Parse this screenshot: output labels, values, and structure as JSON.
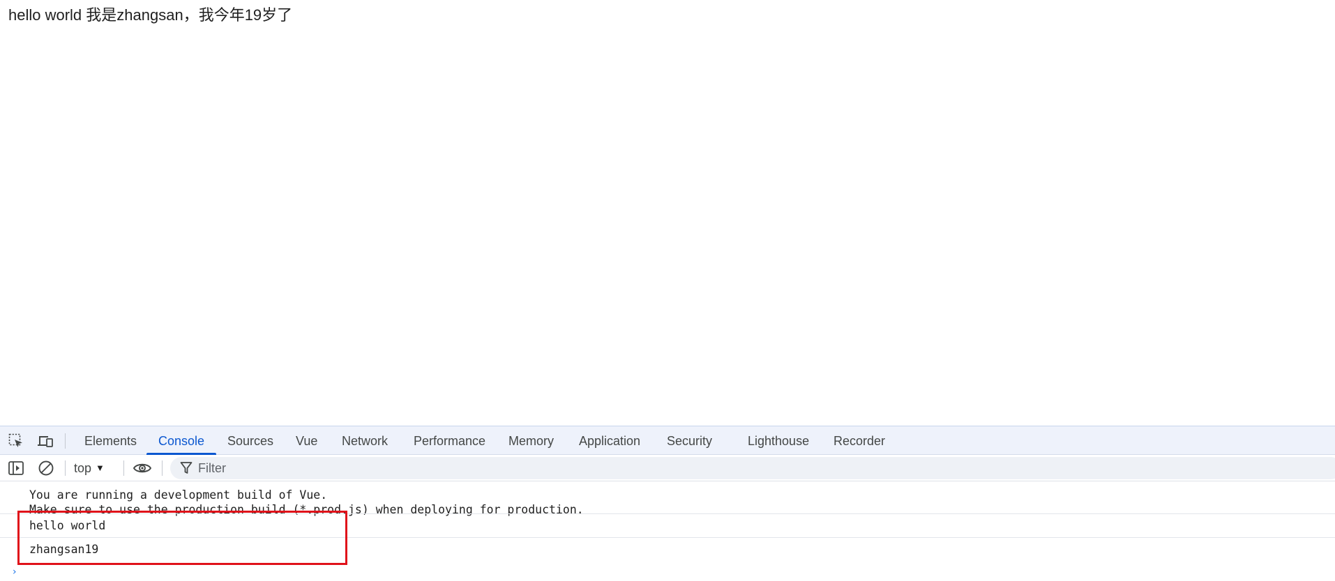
{
  "page": {
    "content_text": "hello world 我是zhangsan，我今年19岁了"
  },
  "devtools": {
    "tabs": [
      {
        "label": "Elements"
      },
      {
        "label": "Console",
        "active": true
      },
      {
        "label": "Sources"
      },
      {
        "label": "Vue"
      },
      {
        "label": "Network"
      },
      {
        "label": "Performance"
      },
      {
        "label": "Memory"
      },
      {
        "label": "Application"
      },
      {
        "label": "Security"
      },
      {
        "label": "Lighthouse"
      },
      {
        "label": "Recorder"
      }
    ],
    "toolbar": {
      "context": "top",
      "filter_placeholder": "Filter"
    },
    "console": {
      "vue_warning_line1": "You are running a development build of Vue.",
      "vue_warning_line2": "Make sure to use the production build (*.prod.js) when deploying for production.",
      "log1": "hello world",
      "log2": "zhangsan19"
    },
    "colors": {
      "accent": "#0b57d0",
      "highlight_box": "#e0121a",
      "tabbar_bg": "#eef2fb"
    },
    "icons": {
      "inspect": "inspect-element-icon",
      "device": "device-toolbar-icon",
      "sidebar": "show-sidebar-icon",
      "clear": "clear-console-icon",
      "live_expression": "eye-icon",
      "filter": "filter-icon",
      "context_arrow": "triangle-down-icon"
    }
  }
}
